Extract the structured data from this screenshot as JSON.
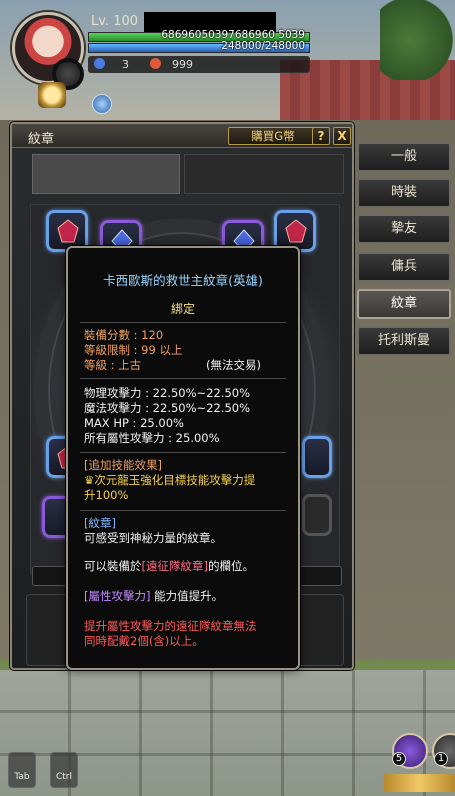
{
  "hud": {
    "level": "Lv. 100",
    "hp_text": "68696050397686960 5039",
    "mp_text": "248000/248000",
    "stat_blue": "3",
    "stat_red": "999"
  },
  "window": {
    "title": "紋章",
    "buy_button": "購買G幣",
    "help_button": "?",
    "close_button": "X"
  },
  "tabs": [
    {
      "label": "一般"
    },
    {
      "label": "時裝"
    },
    {
      "label": "摯友"
    },
    {
      "label": "傭兵"
    },
    {
      "label": "紋章"
    },
    {
      "label": "托利斯曼"
    }
  ],
  "tooltip": {
    "title": "卡西歐斯的救世主紋章(英雄)",
    "bind": "綁定",
    "score": "裝備分數 : 120",
    "level_limit": "等級限制 :  99 以上",
    "grade": "等級 :  上古",
    "trade": "(無法交易)",
    "stats": [
      "物理攻擊力 : 22.50%~22.50%",
      "魔法攻擊力 : 22.50%~22.50%",
      "MAX HP :  25.00%",
      "所有屬性攻擊力 : 25.00%"
    ],
    "skill_header": "[追加技能效果]",
    "skill_line1": "次元龍玉強化目標技能攻擊力提",
    "skill_line2": "升100%",
    "emblem_header": "[紋章]",
    "emblem_desc": "可感受到神秘力量的紋章。",
    "equip_prefix": "可以裝備於",
    "equip_slot": "[遠征隊紋章]",
    "equip_suffix": "的欄位。",
    "attr_header": "[屬性攻擊力]",
    "attr_desc": " 能力值提升。",
    "warning_line1": "提升屬性攻擊力的遠征隊紋章無法",
    "warning_line2": "同時配戴2個(含)以上。"
  },
  "bottom": {
    "tab_key": "Tab",
    "ctrl_key": "Ctrl",
    "skill_slot_5": "5",
    "skill_slot_1": "1"
  },
  "colors": {
    "title_blue": "#9ad4ff",
    "bind_gold": "#f4e08a",
    "score_orange": "#f0a060",
    "skill_gold": "#f4d04a",
    "header_blue": "#7fb4ff",
    "attr_purple": "#c48aff",
    "warning_red": "#ff5a5a"
  }
}
